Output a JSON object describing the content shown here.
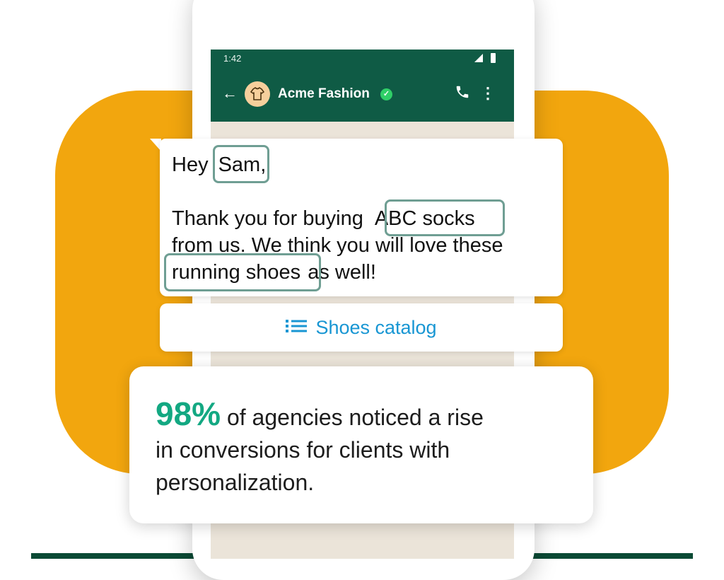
{
  "status": {
    "time": "1:42"
  },
  "chat": {
    "contact_name": "Acme Fashion"
  },
  "message": {
    "greeting": "Hey",
    "name": "Sam",
    "comma": ",",
    "line2_pre": "Thank you for buying",
    "product": "ABC socks",
    "line3": "from us. We think you will love these",
    "recommendation": "running shoes",
    "line4_post": "as well!"
  },
  "cta": {
    "label": "Shoes catalog"
  },
  "stat": {
    "percent": "98%",
    "line1_rest": " of agencies noticed a rise",
    "line2": "in conversions for clients with",
    "line3": "personalization."
  },
  "colors": {
    "brand_green": "#0f5b45",
    "accent_orange": "#f2a60e",
    "highlight_teal": "#6f9e93",
    "link_blue": "#1896d3",
    "stat_green": "#13a882"
  },
  "icons": [
    "back-arrow-icon",
    "tshirt-icon",
    "verified-check-icon",
    "phone-icon",
    "more-vertical-icon",
    "list-icon",
    "signal-icon",
    "battery-icon"
  ]
}
